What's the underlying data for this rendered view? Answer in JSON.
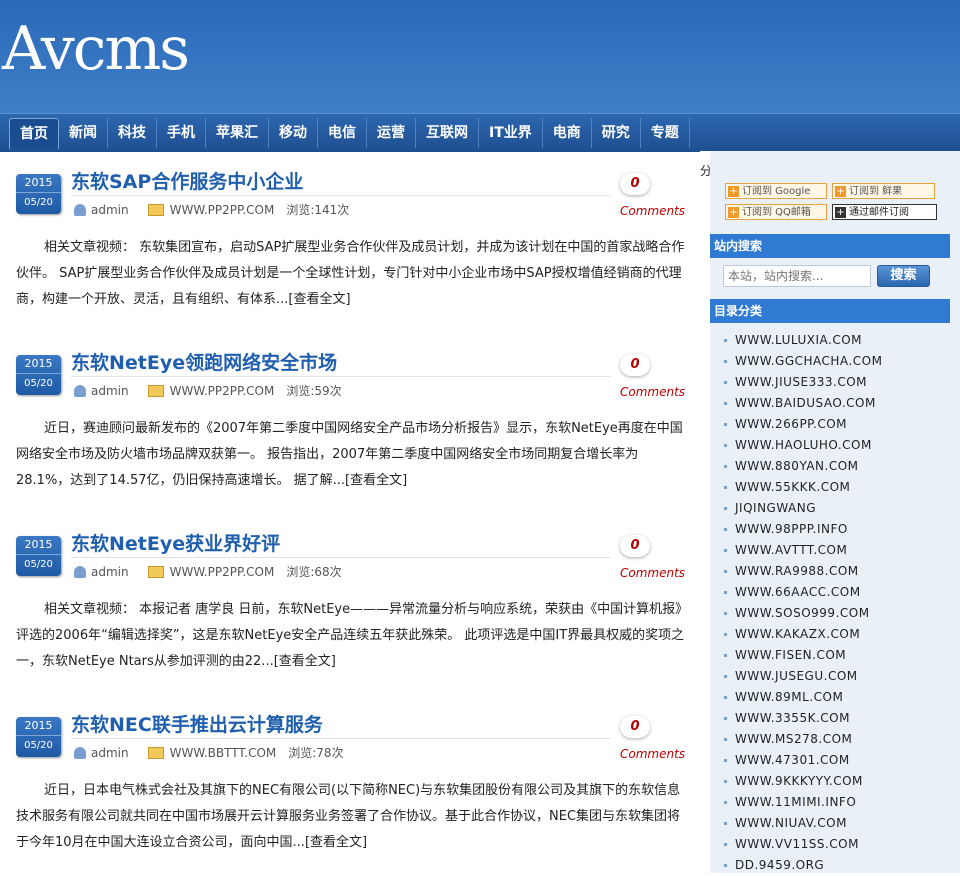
{
  "site": {
    "logo": "Avcms"
  },
  "nav": {
    "items": [
      "首页",
      "新闻",
      "科技",
      "手机",
      "苹果汇",
      "移动",
      "电信",
      "运营",
      "互联网",
      "IT业界",
      "电商",
      "研究",
      "专题"
    ]
  },
  "posts": [
    {
      "year": "2015",
      "monthday": "05/20",
      "title": "东软SAP合作服务中小企业",
      "author": "admin",
      "source": "WWW.PP2PP.COM",
      "views": "浏览:141次",
      "comments": "0",
      "comments_label": "Comments",
      "excerpt": "相关文章视频： 东软集团宣布，启动SAP扩展型业务合作伙伴及成员计划，并成为该计划在中国的首家战略合作伙伴。 SAP扩展型业务合作伙伴及成员计划是一个全球性计划，专门针对中小企业市场中SAP授权增值经销商的代理商，构建一个开放、灵活，且有组织、有体系...",
      "more": "[查看全文]"
    },
    {
      "year": "2015",
      "monthday": "05/20",
      "title": "东软NetEye领跑网络安全市场",
      "author": "admin",
      "source": "WWW.PP2PP.COM",
      "views": "浏览:59次",
      "comments": "0",
      "comments_label": "Comments",
      "excerpt": "近日，赛迪顾问最新发布的《2007年第二季度中国网络安全产品市场分析报告》显示，东软NetEye再度在中国网络安全市场及防火墙市场品牌双获第一。 报告指出，2007年第二季度中国网络安全市场同期复合增长率为28.1%，达到了14.57亿，仍旧保持高速增长。 据了解...",
      "more": "[查看全文]"
    },
    {
      "year": "2015",
      "monthday": "05/20",
      "title": "东软NetEye获业界好评",
      "author": "admin",
      "source": "WWW.PP2PP.COM",
      "views": "浏览:68次",
      "comments": "0",
      "comments_label": "Comments",
      "excerpt": "相关文章视频： 本报记者 唐学良 日前，东软NetEye———异常流量分析与响应系统，荣获由《中国计算机报》评选的2006年“编辑选择奖”，这是东软NetEye安全产品连续五年获此殊荣。 此项评选是中国IT界最具权威的奖项之一，东软NetEye Ntars从参加评测的由22...",
      "more": "[查看全文]"
    },
    {
      "year": "2015",
      "monthday": "05/20",
      "title": "东软NEC联手推出云计算服务",
      "author": "admin",
      "source": "WWW.BBTTT.COM",
      "views": "浏览:78次",
      "comments": "0",
      "comments_label": "Comments",
      "excerpt": "近日，日本电气株式会社及其旗下的NEC有限公司(以下简称NEC)与东软集团股份有限公司及其旗下的东软信息技术服务有限公司就共同在中国市场展开云计算服务业务签署了合作协议。基于此合作协议，NEC集团与东软集团将于今年10月在中国大连设立合资公司，面向中国...",
      "more": "[查看全文]"
    }
  ],
  "sidebar": {
    "share_label": "分享到：",
    "subscribe": {
      "google": "订阅到 Google",
      "xianguo": "订阅到 鲜果",
      "qqmail": "订阅到 QQ邮箱",
      "email": "通过邮件订阅"
    },
    "search_title": "站内搜索",
    "search_placeholder": "本站，站内搜索...",
    "search_button": "搜索",
    "category_title": "目录分类",
    "categories": [
      "WWW.LULUXIA.COM",
      "WWW.GGCHACHA.COM",
      "WWW.JIUSE333.COM",
      "WWW.BAIDUSAO.COM",
      "WWW.266PP.COM",
      "WWW.HAOLUHO.COM",
      "WWW.880YAN.COM",
      "WWW.55KKK.COM",
      "JIQINGWANG",
      "WWW.98PPP.INFO",
      "WWW.AVTTT.COM",
      "WWW.RA9988.COM",
      "WWW.66AACC.COM",
      "WWW.SOSO999.COM",
      "WWW.KAKAZX.COM",
      "WWW.FISEN.COM",
      "WWW.JUSEGU.COM",
      "WWW.89ML.COM",
      "WWW.3355K.COM",
      "WWW.MS278.COM",
      "WWW.47301.COM",
      "WWW.9KKKYYY.COM",
      "WWW.11MIMI.INFO",
      "WWW.NIUAV.COM",
      "WWW.VV11SS.COM",
      "DD.9459.ORG"
    ]
  }
}
